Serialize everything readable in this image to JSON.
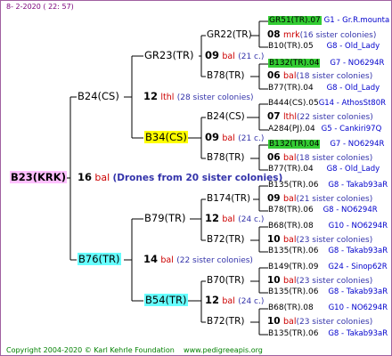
{
  "header": {
    "date": "8-  2-2020 ( 22: 57)"
  },
  "root": {
    "label": "B23(KRK)",
    "number": "16",
    "tag": "bal",
    "note": "(Drones from 20 sister colonies)"
  },
  "gen1": [
    {
      "label": "B24(CS)",
      "number": "12",
      "tag": "lthl",
      "note": "(28 sister colonies)"
    },
    {
      "label": "B76(TR)",
      "number": "14",
      "tag": "bal",
      "note": "(22 sister colonies)"
    }
  ],
  "gen2": [
    {
      "label": "GR23(TR)",
      "number": "09",
      "tag": "bal",
      "note": "(21 c.)"
    },
    {
      "label": "B34(CS)",
      "number": "09",
      "tag": "bal",
      "note": "(21 c.)"
    },
    {
      "label": "B79(TR)",
      "number": "12",
      "tag": "bal",
      "note": "(24 c.)"
    },
    {
      "label": "B54(TR)",
      "number": "12",
      "tag": "bal",
      "note": "(24 c.)"
    }
  ],
  "gen3": [
    {
      "label": "GR22(TR)",
      "number": "08",
      "tag": "mrk",
      "note": "(16 sister colonies)"
    },
    {
      "label": "B78(TR)",
      "number": "06",
      "tag": "bal",
      "note": "(18 sister colonies)"
    },
    {
      "label": "B24(CS)",
      "number": "07",
      "tag": "lthl",
      "note": "(22 sister colonies)"
    },
    {
      "label": "B78(TR)",
      "number": "06",
      "tag": "bal",
      "note": "(18 sister colonies)"
    },
    {
      "label": "B174(TR)",
      "number": "09",
      "tag": "bal",
      "note": "(21 sister colonies)"
    },
    {
      "label": "B72(TR)",
      "number": "10",
      "tag": "bal",
      "note": "(23 sister colonies)"
    },
    {
      "label": "B70(TR)",
      "number": "10",
      "tag": "bal",
      "note": "(23 sister colonies)"
    },
    {
      "label": "B72(TR)",
      "number": "10",
      "tag": "bal",
      "note": "(23 sister colonies)"
    }
  ],
  "gen4": [
    {
      "label": "GR51(TR).07",
      "source": "G1 - Gr.R.mounta"
    },
    {
      "label": "B10(TR).05",
      "source": "G8 - Old_Lady"
    },
    {
      "label": "B132(TR).04",
      "source": "G7 - NO6294R"
    },
    {
      "label": "B77(TR).04",
      "source": "G8 - Old_Lady"
    },
    {
      "label": "B444(CS).05",
      "source": "G14 - AthosSt80R"
    },
    {
      "label": "A284(PJ).04",
      "source": "G5 - Cankiri97Q"
    },
    {
      "label": "B132(TR).04",
      "source": "G7 - NO6294R"
    },
    {
      "label": "B77(TR).04",
      "source": "G8 - Old_Lady"
    },
    {
      "label": "B135(TR).06",
      "source": "G8 - Takab93aR"
    },
    {
      "label": "B78(TR).06",
      "source": "G8 - NO6294R"
    },
    {
      "label": "B68(TR).08",
      "source": "G10 - NO6294R"
    },
    {
      "label": "B135(TR).06",
      "source": "G8 - Takab93aR"
    },
    {
      "label": "B149(TR).09",
      "source": "G24 - Sinop62R"
    },
    {
      "label": "B135(TR).06",
      "source": "G8 - Takab93aR"
    },
    {
      "label": "B68(TR).08",
      "source": "G10 - NO6294R"
    },
    {
      "label": "B135(TR).06",
      "source": "G8 - Takab93aR"
    }
  ],
  "footer": {
    "copyright": "Copyright 2004-2020 © Karl Kehrle Foundation",
    "website": "www.pedigreeapis.org"
  }
}
